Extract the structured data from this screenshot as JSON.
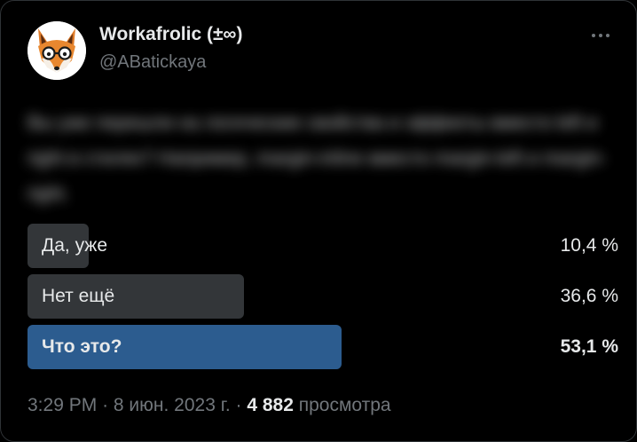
{
  "author": {
    "name": "Workafrolic (±∞)",
    "handle": "@ABatickaya",
    "avatar_icon": "fox-with-glasses-icon"
  },
  "tweet": {
    "blurred": true,
    "text": "Вы уже перешли на логические свойства и эффекты вместо left и right в стилях? Например, margin-inline вместо margin-left и margin-right."
  },
  "poll": {
    "options": [
      {
        "label": "Да, уже",
        "percent_text": "10,4 %",
        "percent": 10.4,
        "winner": false
      },
      {
        "label": "Нет ещё",
        "percent_text": "36,6 %",
        "percent": 36.6,
        "winner": false
      },
      {
        "label": "Что это?",
        "percent_text": "53,1 %",
        "percent": 53.1,
        "winner": true
      }
    ]
  },
  "meta": {
    "time": "3:29 PM",
    "separator": "·",
    "date": "8 июн. 2023 г.",
    "views_count": "4 882",
    "views_label": "просмотра"
  },
  "colors": {
    "background": "#000000",
    "text_primary": "#e7e9ea",
    "text_secondary": "#71767b",
    "poll_bar": "#333639",
    "poll_bar_winner": "#2c5c8f"
  },
  "icons": {
    "more": "more-dots-icon"
  }
}
